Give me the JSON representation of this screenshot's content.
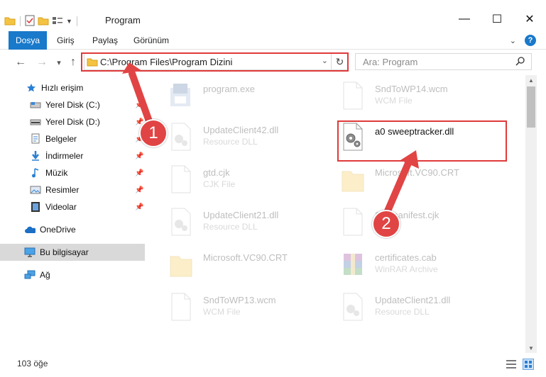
{
  "window": {
    "title": "Program",
    "minimize": "—",
    "maximize": "☐",
    "close": "✕"
  },
  "ribbon": {
    "file_tab": "Dosya",
    "tabs": [
      "Giriş",
      "Paylaş",
      "Görünüm"
    ],
    "help": "?"
  },
  "nav": {
    "back": "←",
    "forward": "→",
    "recent": "▾",
    "up": "↑",
    "address": "C:\\Program Files\\Program Dizini",
    "dropdown": "⌄",
    "refresh": "↻",
    "search_placeholder": "Ara: Program"
  },
  "sidebar": {
    "items": [
      {
        "label": "Hızlı erişim",
        "icon": "star-icon"
      },
      {
        "label": "Yerel Disk (C:)",
        "icon": "drive-icon"
      },
      {
        "label": "Yerel Disk (D:)",
        "icon": "drive-icon"
      },
      {
        "label": "Belgeler",
        "icon": "documents-icon"
      },
      {
        "label": "İndirmeler",
        "icon": "download-icon"
      },
      {
        "label": "Müzik",
        "icon": "music-icon"
      },
      {
        "label": "Resimler",
        "icon": "pictures-icon"
      },
      {
        "label": "Videolar",
        "icon": "video-icon"
      },
      {
        "label": "OneDrive",
        "icon": "cloud-icon"
      },
      {
        "label": "Bu bilgisayar",
        "icon": "computer-icon"
      },
      {
        "label": "Ağ",
        "icon": "network-icon"
      }
    ]
  },
  "files": [
    {
      "name": "program.exe",
      "type": ""
    },
    {
      "name": "SndToWP14.wcm",
      "type": "WCM File"
    },
    {
      "name": "UpdateClient42.dll",
      "type": "Resource DLL"
    },
    {
      "name": "a0 sweeptracker.dll",
      "type": ""
    },
    {
      "name": "gtd.cjk",
      "type": "CJK File"
    },
    {
      "name": "Microsoft.VC90.CRT",
      "type": ""
    },
    {
      "name": "UpdateClient21.dll",
      "type": "Resource DLL"
    },
    {
      "name": "Sxsmanifest.cjk",
      "type": ""
    },
    {
      "name": "Microsoft.VC90.CRT",
      "type": ""
    },
    {
      "name": "certificates.cab",
      "type": "WinRAR Archive"
    },
    {
      "name": "SndToWP13.wcm",
      "type": "WCM File"
    },
    {
      "name": "UpdateClient21.dll",
      "type": "Resource DLL"
    }
  ],
  "status": {
    "count": "103 öğe"
  },
  "annotations": {
    "badge1": "1",
    "badge2": "2",
    "color": "#e14444"
  }
}
